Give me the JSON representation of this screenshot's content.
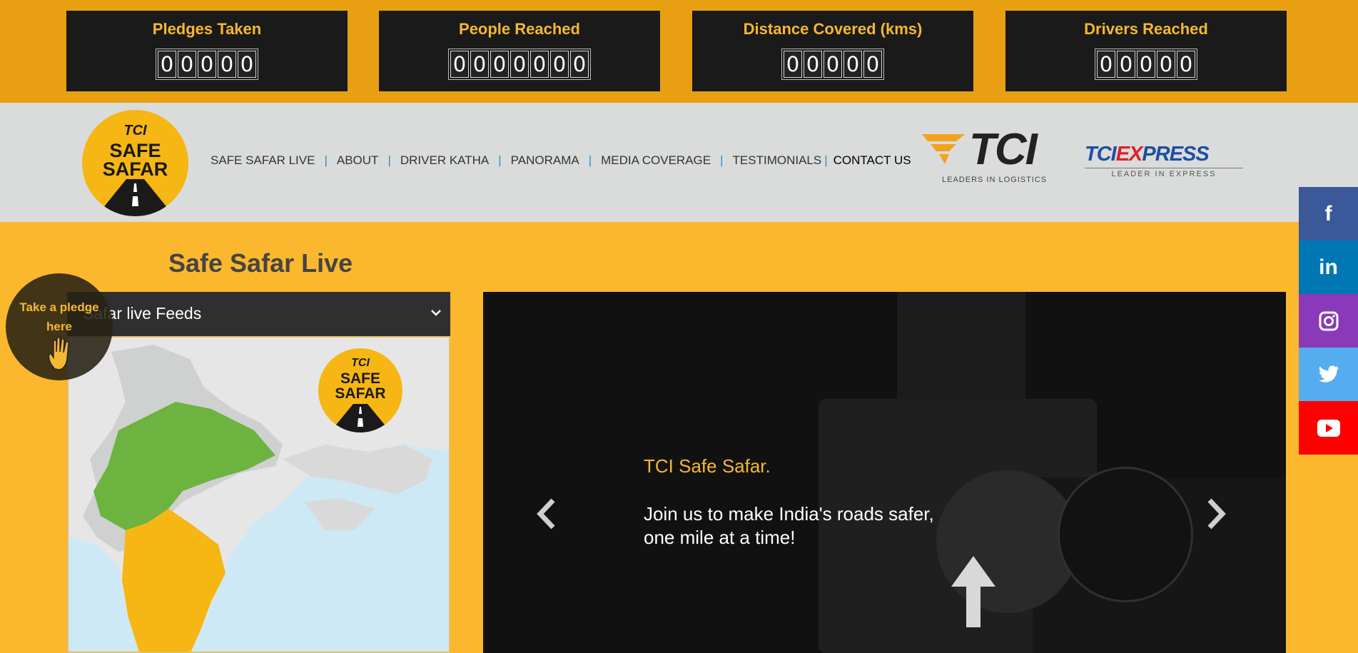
{
  "stats": [
    {
      "title": "Pledges Taken",
      "digits": [
        "0",
        "0",
        "0",
        "0",
        "0"
      ]
    },
    {
      "title": "People Reached",
      "digits": [
        "0",
        "0",
        "0",
        "0",
        "0",
        "0",
        "0"
      ]
    },
    {
      "title": "Distance Covered (kms)",
      "digits": [
        "0",
        "0",
        "0",
        "0",
        "0"
      ]
    },
    {
      "title": "Drivers Reached",
      "digits": [
        "0",
        "0",
        "0",
        "0",
        "0"
      ]
    }
  ],
  "header": {
    "logo_tci": "TCI",
    "logo_safe": "SAFE",
    "logo_safar": "SAFAR",
    "nav": [
      {
        "label": "SAFE SAFAR LIVE"
      },
      {
        "label": "ABOUT"
      },
      {
        "label": "DRIVER KATHA"
      },
      {
        "label": "PANORAMA"
      },
      {
        "label": "MEDIA COVERAGE"
      },
      {
        "label": "TESTIMONIALS"
      },
      {
        "label": "CONTACT US"
      }
    ],
    "separator": "|",
    "tci_logo_text": "TCI",
    "tci_logo_tagline": "LEADERS IN LOGISTICS",
    "tcix_logo_blue1": "TCI",
    "tcix_logo_red": "EX",
    "tcix_logo_blue2": "PRESS",
    "tcix_logo_tagline": "LEADER IN EXPRESS"
  },
  "main": {
    "section_title": "Safe Safar Live",
    "feeds_select": {
      "value": "Safar live Feeds"
    },
    "map_logo_tci": "TCI",
    "map_logo_safe": "SAFE",
    "map_logo_safar": "SAFAR",
    "slide": {
      "title": "TCI Safe Safar.",
      "line1": "Join us to make India's roads safer,",
      "line2": "one mile at a time!"
    }
  },
  "pledge": {
    "line1": "Take a pledge",
    "line2": "here"
  },
  "social": [
    {
      "name": "facebook",
      "glyph": "f",
      "color": "#3b5998"
    },
    {
      "name": "linkedin",
      "glyph": "in",
      "color": "#0077b5"
    },
    {
      "name": "instagram",
      "glyph": "",
      "color": "#8a3ab9"
    },
    {
      "name": "twitter",
      "glyph": "",
      "color": "#55acee"
    },
    {
      "name": "youtube",
      "glyph": "",
      "color": "#ff0000"
    }
  ],
  "colors": {
    "accent": "#f5b830",
    "stats_bar": "#e8a012",
    "page_bg": "#fbb82e",
    "nav_separator": "#2b8cc9"
  }
}
